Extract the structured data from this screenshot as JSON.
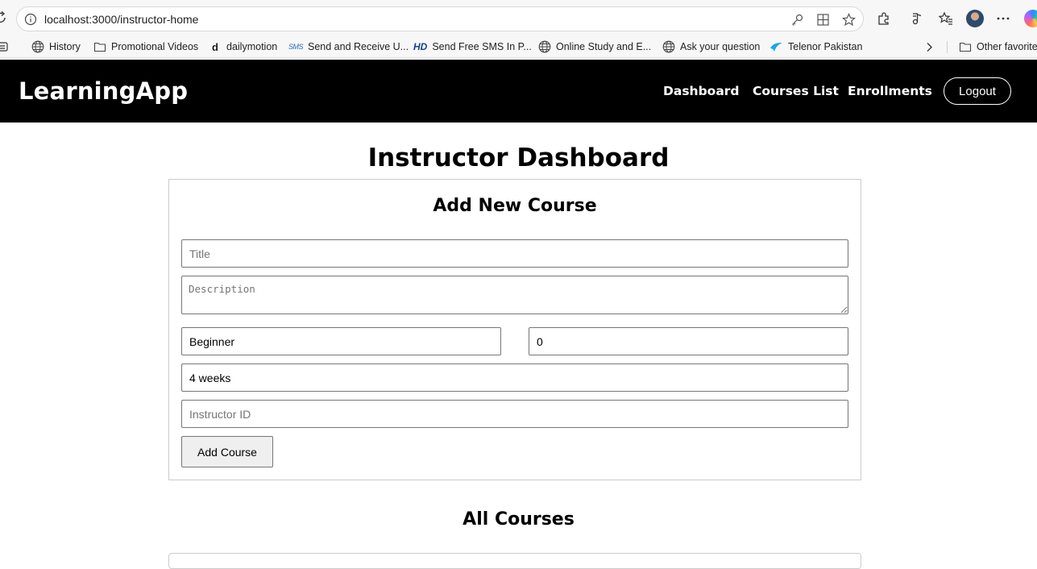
{
  "browser": {
    "url": "localhost:3000/instructor-home",
    "bookmarks": [
      {
        "label": "History",
        "icon": "globe-icon"
      },
      {
        "label": "Promotional Videos",
        "icon": "folder-icon"
      },
      {
        "label": "dailymotion",
        "icon": "dailymotion-icon",
        "glyph": "d"
      },
      {
        "label": "Send and Receive U...",
        "icon": "sms-icon",
        "glyph": "SMS"
      },
      {
        "label": "Send Free SMS In P...",
        "icon": "hd-icon",
        "glyph": "HD"
      },
      {
        "label": "Online Study and E...",
        "icon": "globe-icon"
      },
      {
        "label": "Ask your question",
        "icon": "globe-icon"
      },
      {
        "label": "Telenor Pakistan",
        "icon": "telenor-icon"
      }
    ],
    "other_favorites": "Other favorites"
  },
  "navbar": {
    "brand": "LearningApp",
    "links": [
      "Dashboard",
      "Courses List",
      "Enrollments"
    ],
    "logout_label": "Logout"
  },
  "main": {
    "title": "Instructor Dashboard",
    "form": {
      "heading": "Add New Course",
      "title_placeholder": "Title",
      "description_placeholder": "Description",
      "level_value": "Beginner",
      "price_value": "0",
      "duration_value": "4 weeks",
      "instructor_placeholder": "Instructor ID",
      "submit_label": "Add Course"
    },
    "courses_heading": "All Courses"
  },
  "colors": {
    "navbar_bg": "#000000",
    "navbar_text": "#ffffff",
    "button_bg": "#efefef",
    "border": "#767676"
  }
}
